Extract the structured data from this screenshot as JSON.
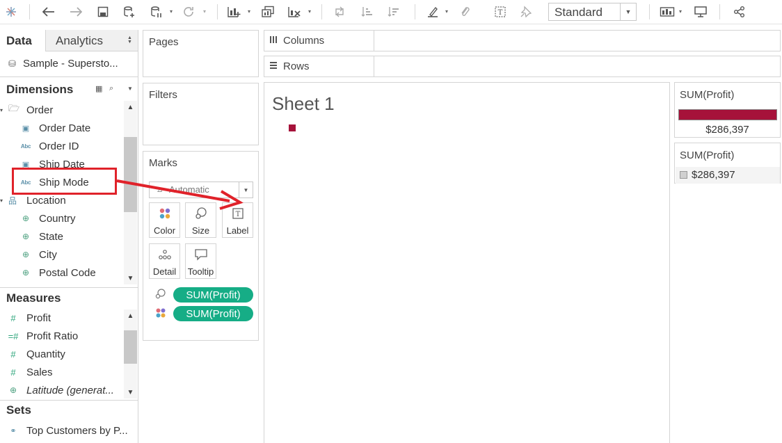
{
  "toolbar": {
    "fit_mode": "Standard"
  },
  "data_pane": {
    "tab_data": "Data",
    "tab_analytics": "Analytics",
    "datasource": "Sample - Supersto...",
    "dimensions_label": "Dimensions",
    "dimension_items": [
      {
        "label": "Order",
        "kind": "folder"
      },
      {
        "label": "Order Date",
        "kind": "date"
      },
      {
        "label": "Order ID",
        "kind": "string"
      },
      {
        "label": "Ship Date",
        "kind": "date"
      },
      {
        "label": "Ship Mode",
        "kind": "string"
      },
      {
        "label": "Location",
        "kind": "hierarchy"
      },
      {
        "label": "Country",
        "kind": "geo"
      },
      {
        "label": "State",
        "kind": "geo"
      },
      {
        "label": "City",
        "kind": "geo"
      },
      {
        "label": "Postal Code",
        "kind": "geo"
      }
    ],
    "measures_label": "Measures",
    "measure_items": [
      {
        "label": "Profit",
        "kind": "measure"
      },
      {
        "label": "Profit Ratio",
        "kind": "calc"
      },
      {
        "label": "Quantity",
        "kind": "measure"
      },
      {
        "label": "Sales",
        "kind": "measure"
      },
      {
        "label": "Latitude (generat...",
        "kind": "geo"
      }
    ],
    "sets_label": "Sets",
    "set_items": [
      {
        "label": "Top Customers by P...",
        "kind": "set"
      }
    ]
  },
  "shelves": {
    "pages": "Pages",
    "filters": "Filters",
    "columns": "Columns",
    "rows": "Rows"
  },
  "marks": {
    "title": "Marks",
    "mark_type": "Automatic",
    "buttons": {
      "color": "Color",
      "size": "Size",
      "label": "Label",
      "detail": "Detail",
      "tooltip": "Tooltip"
    },
    "pills": [
      {
        "label": "SUM(Profit)",
        "encoding": "size"
      },
      {
        "label": "SUM(Profit)",
        "encoding": "color"
      }
    ]
  },
  "view": {
    "sheet_title": "Sheet 1",
    "mark_color": "#a6123a"
  },
  "legends": {
    "color_legend": {
      "title": "SUM(Profit)",
      "value": "$286,397",
      "color": "#a6123a"
    },
    "size_legend": {
      "title": "SUM(Profit)",
      "value": "$286,397"
    }
  },
  "annotation": {
    "highlight_color": "#e0222a",
    "note": "Ship Mode dragged to Label"
  }
}
